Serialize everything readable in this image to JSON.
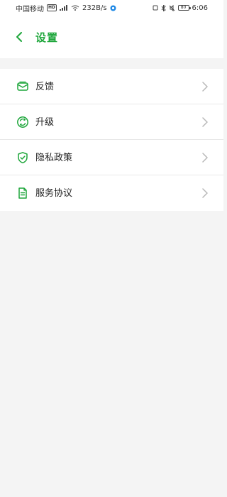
{
  "status_bar": {
    "carrier": "中国移动",
    "speed": "232B/s",
    "battery": "80",
    "time": "6:06"
  },
  "header": {
    "title": "设置"
  },
  "menu": {
    "items": [
      {
        "label": "反馈",
        "icon": "feedback-icon"
      },
      {
        "label": "升级",
        "icon": "upgrade-icon"
      },
      {
        "label": "隐私政策",
        "icon": "privacy-policy-icon"
      },
      {
        "label": "服务协议",
        "icon": "service-agreement-icon"
      }
    ]
  },
  "colors": {
    "accent": "#1ea63b",
    "background": "#f4f4f4",
    "surface": "#ffffff"
  }
}
